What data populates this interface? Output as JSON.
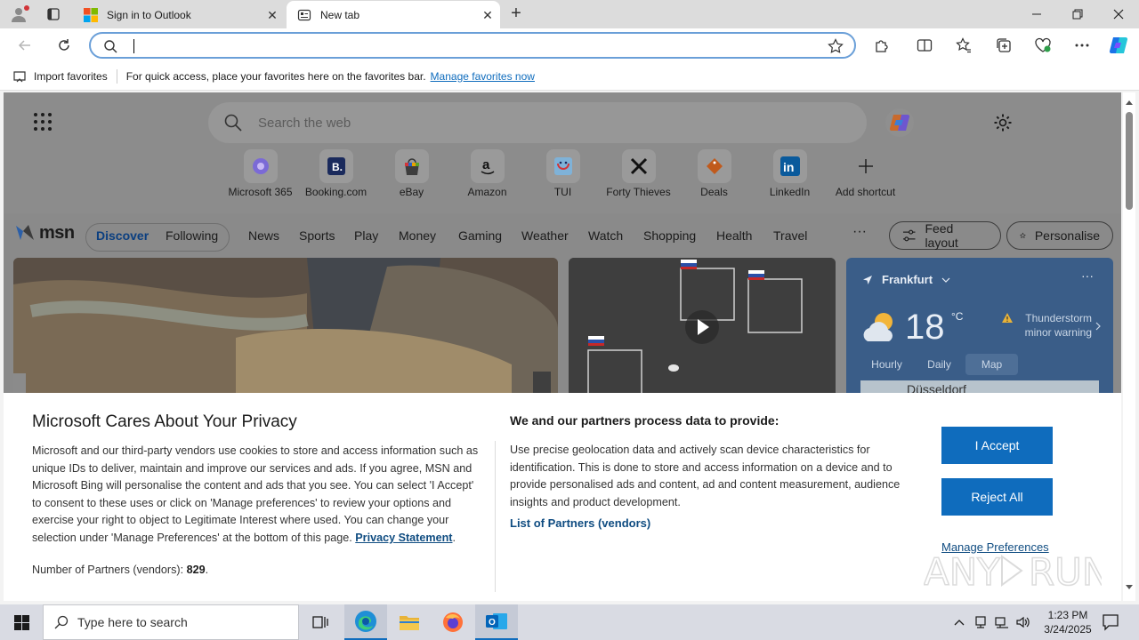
{
  "browser": {
    "tabs": [
      {
        "title": "Sign in to Outlook",
        "active": false
      },
      {
        "title": "New tab",
        "active": true
      }
    ],
    "address": {
      "value": "",
      "placeholder": ""
    },
    "favorites_bar": {
      "import_label": "Import favorites",
      "hint": "For quick access, place your favorites here on the favorites bar.",
      "manage_link": "Manage favorites now"
    }
  },
  "newtab": {
    "search_placeholder": "Search the web",
    "shortcuts": [
      {
        "label": "Microsoft 365",
        "icon": "microsoft365-icon"
      },
      {
        "label": "Booking.com",
        "icon": "booking-icon"
      },
      {
        "label": "eBay",
        "icon": "ebay-icon"
      },
      {
        "label": "Amazon",
        "icon": "amazon-icon"
      },
      {
        "label": "TUI",
        "icon": "tui-icon"
      },
      {
        "label": "Forty Thieves",
        "icon": "forty-thieves-icon"
      },
      {
        "label": "Deals",
        "icon": "deals-icon"
      },
      {
        "label": "LinkedIn",
        "icon": "linkedin-icon"
      },
      {
        "label": "Add shortcut",
        "icon": "plus-icon"
      }
    ],
    "msn": {
      "logo_text": "msn",
      "tabs": [
        "Discover",
        "Following"
      ],
      "nav": [
        "News",
        "Sports",
        "Play",
        "Money",
        "Gaming",
        "Weather",
        "Watch",
        "Shopping",
        "Health",
        "Travel"
      ],
      "more": "···",
      "feed_layout": "Feed layout",
      "personalise": "Personalise"
    },
    "weather": {
      "location": "Frankfurt",
      "temperature": "18",
      "unit": "°C",
      "warning": "Thunderstorm minor warning",
      "tabs": [
        "Hourly",
        "Daily",
        "Map"
      ],
      "active_tab": "Map",
      "map_label": "Düsseldorf"
    }
  },
  "privacy": {
    "title": "Microsoft Cares About Your Privacy",
    "body": "Microsoft and our third-party vendors use cookies to store and access information such as unique IDs to deliver, maintain and improve our services and ads. If you agree, MSN and Microsoft Bing will personalise the content and ads that you see. You can select 'I Accept' to consent to these uses or click on 'Manage preferences' to review your options and exercise your right to object to Legitimate Interest where used.  You can change your selection under 'Manage Preferences' at the bottom of this page.",
    "privacy_link": "Privacy Statement",
    "partners_count_label": "Number of Partners (vendors):",
    "partners_count": "829",
    "subtitle": "We and our partners process data to provide:",
    "sub_body": "Use precise geolocation data and actively scan device characteristics for identification. This is done to store and access information on a device and to provide personalised ads and content, ad and content measurement, audience insights and product development.",
    "partners_link": "List of Partners (vendors)",
    "accept": "I Accept",
    "reject": "Reject All",
    "manage": "Manage Preferences"
  },
  "taskbar": {
    "search_placeholder": "Type here to search",
    "time": "1:23 PM",
    "date": "3/24/2025"
  },
  "colors": {
    "accent": "#0f6cbd",
    "weather_card": "#3a5d88"
  }
}
